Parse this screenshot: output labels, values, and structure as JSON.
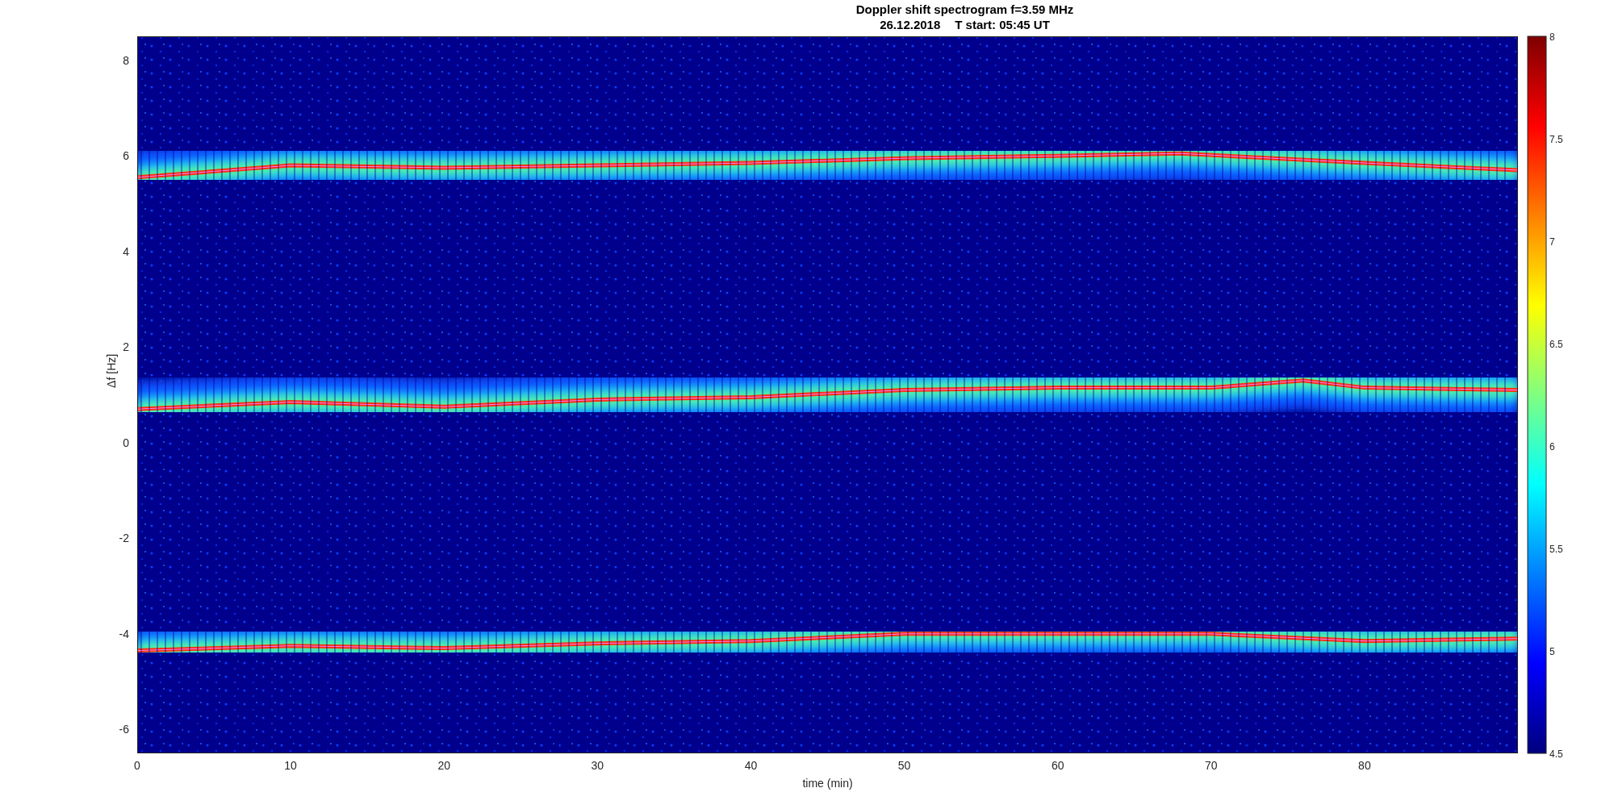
{
  "figure": {
    "title": "Doppler shift spectrogram f=3.59 MHz",
    "subtitle": [
      "26.12.2018",
      "T start: 05:45 UT"
    ],
    "xlabel": "time (min)",
    "ylabel": "Δf [Hz]",
    "xticks": [
      "0",
      "10",
      "20",
      "30",
      "40",
      "50",
      "60",
      "70",
      "80"
    ],
    "yticks": [
      "8",
      "6",
      "4",
      "2",
      "0",
      "-2",
      "-4",
      "-6"
    ],
    "colorbar_ticks": [
      "8",
      "7.5",
      "7",
      "6.5",
      "6",
      "5.5",
      "5",
      "4.5"
    ]
  }
}
